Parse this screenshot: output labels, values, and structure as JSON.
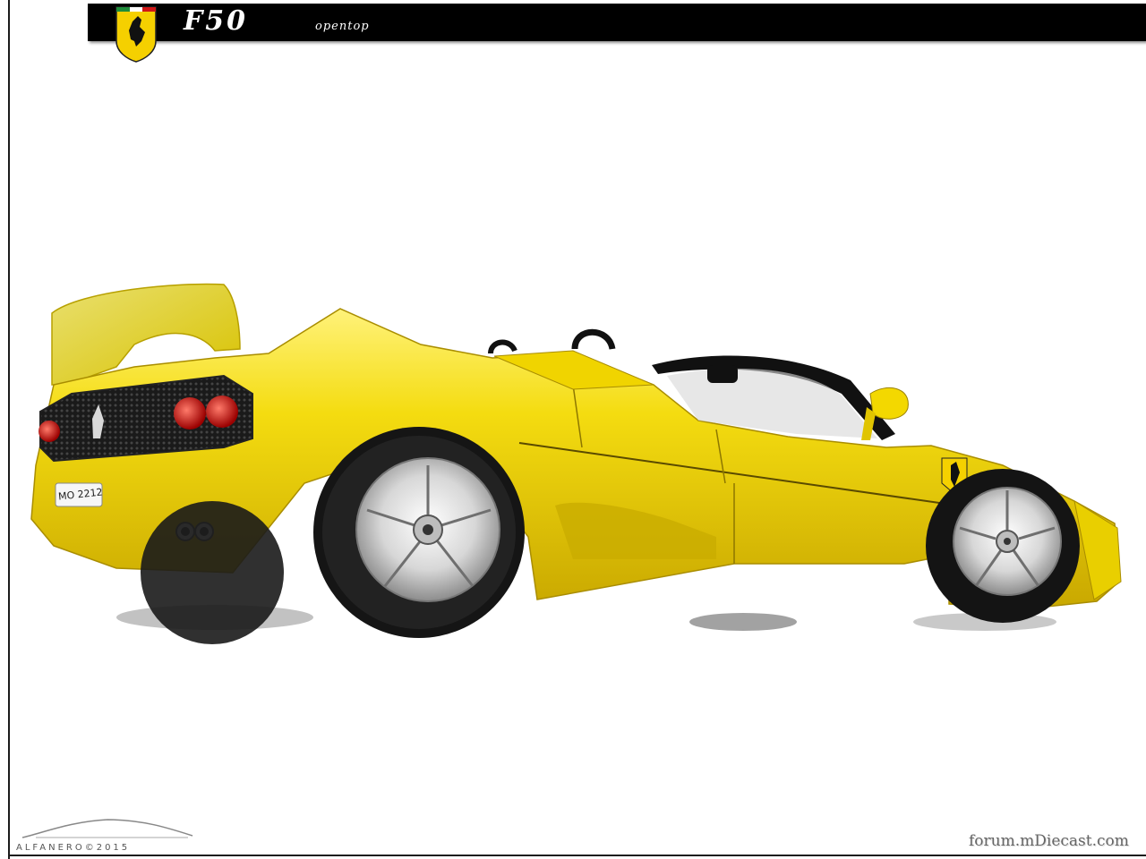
{
  "header": {
    "title": "F50",
    "subtitle": "opentop",
    "badge_icon": "ferrari-prancing-horse-shield-icon"
  },
  "watermarks": {
    "bottom_left": "ALFANERO©2015",
    "bottom_right": "forum.mDiecast.com"
  },
  "photo": {
    "license_plate": "MO 2212",
    "car_color": "#f0d400",
    "background_color": "#ffffff"
  }
}
